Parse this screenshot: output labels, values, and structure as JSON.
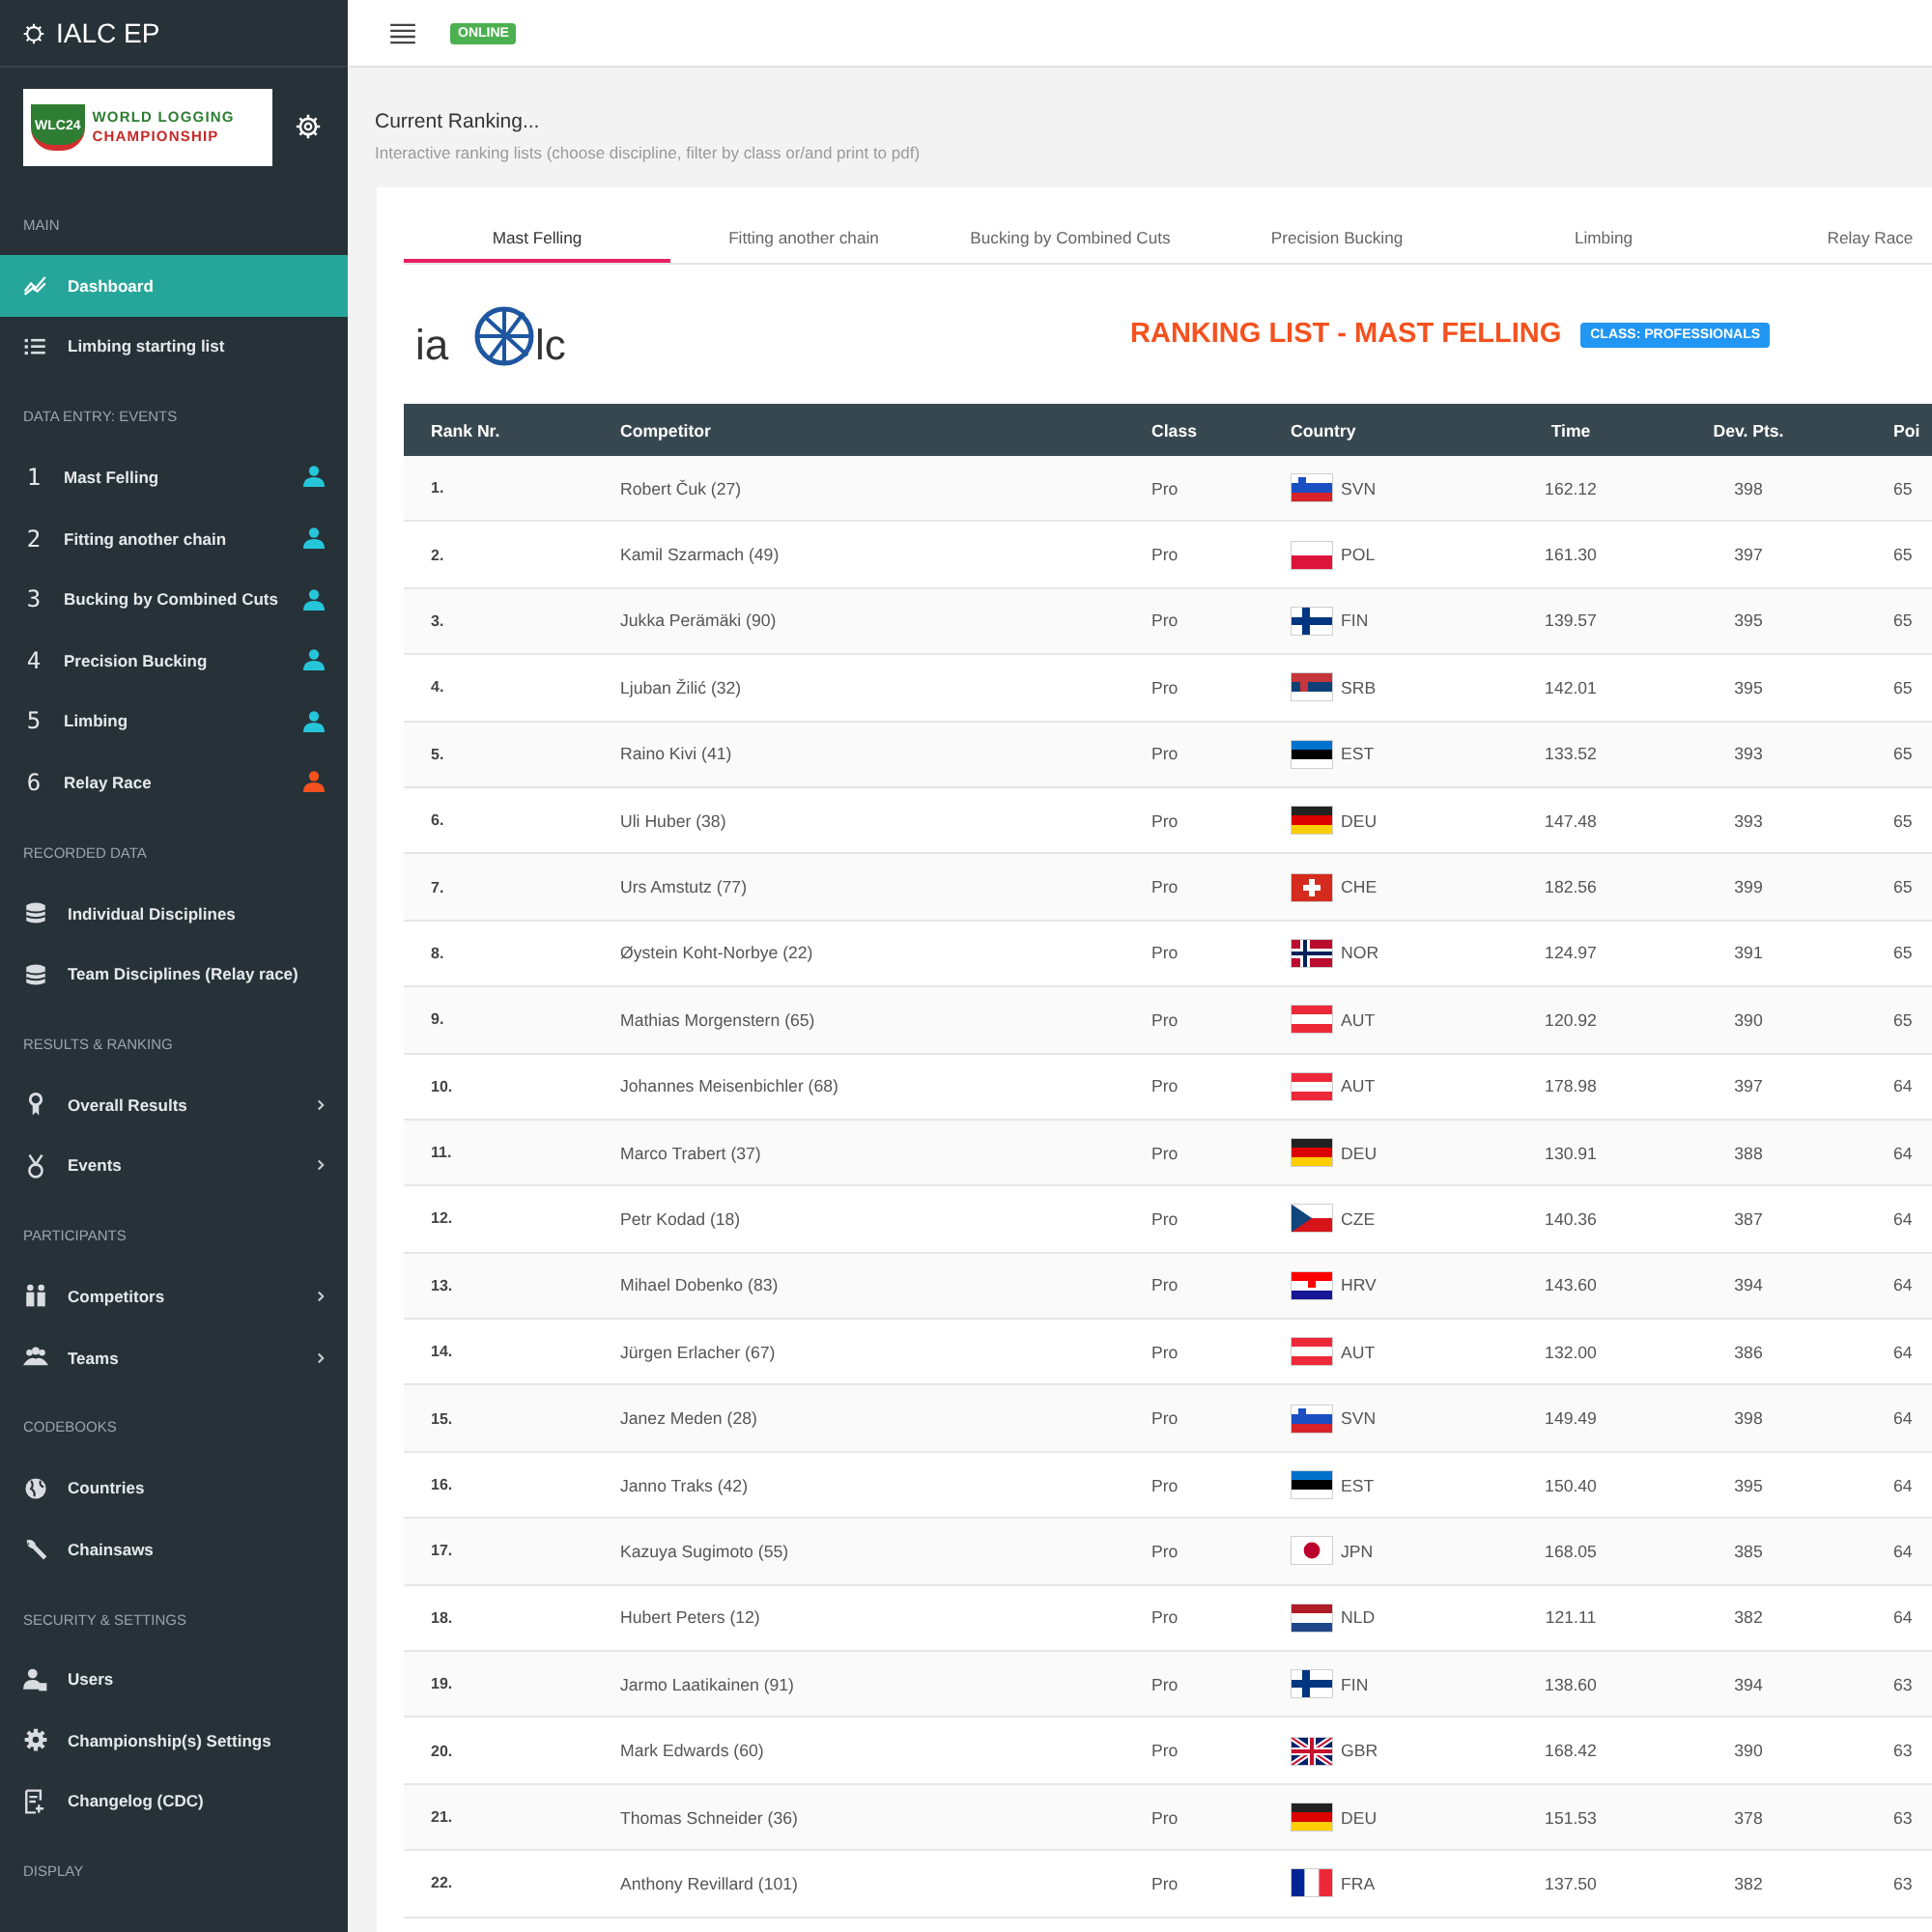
{
  "sidebar": {
    "app_title": "IALC EP",
    "logo": {
      "badge": "WLC24",
      "line_1": "WORLD LOGGING",
      "line_2": "CHAMPIONSHIP"
    },
    "sections": [
      {
        "header": "MAIN",
        "items": [
          {
            "label": "Dashboard",
            "selected": true
          },
          {
            "label": "Limbing starting list",
            "selected": false
          }
        ]
      },
      {
        "header": "DATA ENTRY: EVENTS",
        "items": [
          {
            "kind": "event",
            "number": "1",
            "label": "Mast Felling",
            "selected": false,
            "color": "#26c6da"
          },
          {
            "kind": "event",
            "number": "2",
            "label": "Fitting another chain",
            "selected": false,
            "color": "#26c6da"
          },
          {
            "kind": "event",
            "number": "3",
            "label": "Bucking by Combined Cuts",
            "selected": false,
            "color": "#26c6da"
          },
          {
            "kind": "event",
            "number": "4",
            "label": "Precision Bucking",
            "selected": false,
            "color": "#26c6da"
          },
          {
            "kind": "event",
            "number": "5",
            "label": "Limbing",
            "selected": false,
            "color": "#26c6da"
          },
          {
            "kind": "event",
            "number": "6",
            "label": "Relay Race",
            "selected": false,
            "color": "#f4511e"
          }
        ]
      },
      {
        "header": "RECORDED DATA",
        "items": [
          {
            "label": "Individual Disciplines",
            "selected": false
          },
          {
            "label": "Team Disciplines (Relay race)",
            "selected": false
          }
        ]
      },
      {
        "header": "RESULTS & RANKING",
        "items": [
          {
            "label": "Overall Results",
            "selected": false,
            "expandable": true
          },
          {
            "label": "Events",
            "selected": false,
            "expandable": true
          }
        ]
      },
      {
        "header": "PARTICIPANTS",
        "items": [
          {
            "label": "Competitors",
            "selected": false,
            "expandable": true
          },
          {
            "label": "Teams",
            "selected": false,
            "expandable": true
          }
        ]
      },
      {
        "header": "CODEBOOKS",
        "items": [
          {
            "label": "Countries",
            "selected": false
          },
          {
            "label": "Chainsaws",
            "selected": false
          }
        ]
      },
      {
        "header": "SECURITY & SETTINGS",
        "items": [
          {
            "label": "Users",
            "selected": false
          },
          {
            "label": "Championship(s) Settings",
            "selected": false
          },
          {
            "label": "Changelog (CDC)",
            "selected": false
          }
        ]
      },
      {
        "header": "DISPLAY"
      }
    ]
  },
  "topbar": {
    "status": "ONLINE"
  },
  "page": {
    "title": "Current Ranking...",
    "subtitle": "Interactive ranking lists (choose discipline, filter by class or/and print to pdf)"
  },
  "tabs": [
    {
      "label": "Mast Felling",
      "selected": true
    },
    {
      "label": "Fitting another chain",
      "selected": false
    },
    {
      "label": "Bucking by Combined Cuts",
      "selected": false
    },
    {
      "label": "Precision Bucking",
      "selected": false
    },
    {
      "label": "Limbing",
      "selected": false
    },
    {
      "label": "Relay Race",
      "selected": false
    }
  ],
  "ranking": {
    "logo": {
      "left": "ia",
      "right": "lc"
    },
    "title": "RANKING LIST - MAST FELLING",
    "class_badge": "CLASS: PROFESSIONALS",
    "columns": [
      "Rank Nr.",
      "Competitor",
      "Class",
      "Country",
      "Time",
      "Dev. Pts.",
      "Poi"
    ],
    "rows": [
      {
        "rank": "1.",
        "competitor": "Robert Čuk (27)",
        "class": "Pro",
        "country": "SVN",
        "time": "162.12",
        "dev_pts": "398",
        "points": "65"
      },
      {
        "rank": "2.",
        "competitor": "Kamil Szarmach (49)",
        "class": "Pro",
        "country": "POL",
        "time": "161.30",
        "dev_pts": "397",
        "points": "65"
      },
      {
        "rank": "3.",
        "competitor": "Jukka Perämäki (90)",
        "class": "Pro",
        "country": "FIN",
        "time": "139.57",
        "dev_pts": "395",
        "points": "65"
      },
      {
        "rank": "4.",
        "competitor": "Ljuban Žilić (32)",
        "class": "Pro",
        "country": "SRB",
        "time": "142.01",
        "dev_pts": "395",
        "points": "65"
      },
      {
        "rank": "5.",
        "competitor": "Raino Kivi (41)",
        "class": "Pro",
        "country": "EST",
        "time": "133.52",
        "dev_pts": "393",
        "points": "65"
      },
      {
        "rank": "6.",
        "competitor": "Uli Huber (38)",
        "class": "Pro",
        "country": "DEU",
        "time": "147.48",
        "dev_pts": "393",
        "points": "65"
      },
      {
        "rank": "7.",
        "competitor": "Urs Amstutz (77)",
        "class": "Pro",
        "country": "CHE",
        "time": "182.56",
        "dev_pts": "399",
        "points": "65"
      },
      {
        "rank": "8.",
        "competitor": "Øystein Koht-Norbye (22)",
        "class": "Pro",
        "country": "NOR",
        "time": "124.97",
        "dev_pts": "391",
        "points": "65"
      },
      {
        "rank": "9.",
        "competitor": "Mathias Morgenstern (65)",
        "class": "Pro",
        "country": "AUT",
        "time": "120.92",
        "dev_pts": "390",
        "points": "65"
      },
      {
        "rank": "10.",
        "competitor": "Johannes Meisenbichler (68)",
        "class": "Pro",
        "country": "AUT",
        "time": "178.98",
        "dev_pts": "397",
        "points": "64"
      },
      {
        "rank": "11.",
        "competitor": "Marco Trabert (37)",
        "class": "Pro",
        "country": "DEU",
        "time": "130.91",
        "dev_pts": "388",
        "points": "64"
      },
      {
        "rank": "12.",
        "competitor": "Petr Kodad (18)",
        "class": "Pro",
        "country": "CZE",
        "time": "140.36",
        "dev_pts": "387",
        "points": "64"
      },
      {
        "rank": "13.",
        "competitor": "Mihael Dobenko (83)",
        "class": "Pro",
        "country": "HRV",
        "time": "143.60",
        "dev_pts": "394",
        "points": "64"
      },
      {
        "rank": "14.",
        "competitor": "Jürgen Erlacher (67)",
        "class": "Pro",
        "country": "AUT",
        "time": "132.00",
        "dev_pts": "386",
        "points": "64"
      },
      {
        "rank": "15.",
        "competitor": "Janez Meden (28)",
        "class": "Pro",
        "country": "SVN",
        "time": "149.49",
        "dev_pts": "398",
        "points": "64"
      },
      {
        "rank": "16.",
        "competitor": "Janno Traks (42)",
        "class": "Pro",
        "country": "EST",
        "time": "150.40",
        "dev_pts": "395",
        "points": "64"
      },
      {
        "rank": "17.",
        "competitor": "Kazuya Sugimoto (55)",
        "class": "Pro",
        "country": "JPN",
        "time": "168.05",
        "dev_pts": "385",
        "points": "64"
      },
      {
        "rank": "18.",
        "competitor": "Hubert Peters (12)",
        "class": "Pro",
        "country": "NLD",
        "time": "121.11",
        "dev_pts": "382",
        "points": "64"
      },
      {
        "rank": "19.",
        "competitor": "Jarmo Laatikainen (91)",
        "class": "Pro",
        "country": "FIN",
        "time": "138.60",
        "dev_pts": "394",
        "points": "63"
      },
      {
        "rank": "20.",
        "competitor": "Mark Edwards (60)",
        "class": "Pro",
        "country": "GBR",
        "time": "168.42",
        "dev_pts": "390",
        "points": "63"
      },
      {
        "rank": "21.",
        "competitor": "Thomas Schneider (36)",
        "class": "Pro",
        "country": "DEU",
        "time": "151.53",
        "dev_pts": "378",
        "points": "63"
      },
      {
        "rank": "22.",
        "competitor": "Anthony Revillard (101)",
        "class": "Pro",
        "country": "FRA",
        "time": "137.50",
        "dev_pts": "382",
        "points": "63"
      }
    ]
  }
}
